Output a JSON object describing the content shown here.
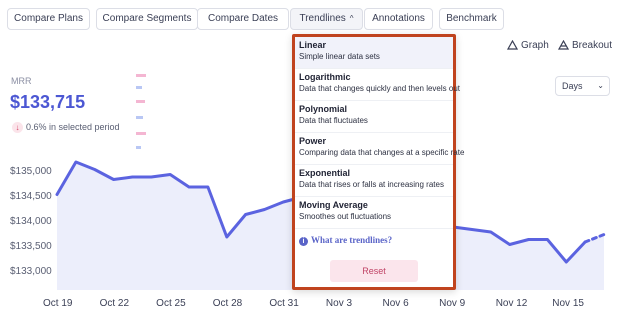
{
  "toolbar": {
    "buttons": [
      "Compare Plans",
      "Compare Segments",
      "Compare Dates",
      "Trendlines",
      "Annotations",
      "Benchmark"
    ],
    "trendlines_caret": "^"
  },
  "actions": {
    "graph": "Graph",
    "breakout": "Breakout"
  },
  "metric": {
    "label": "MRR",
    "value": "$133,715",
    "change": "0.6% in selected period",
    "change_direction": "down"
  },
  "period_select": {
    "value": "Days"
  },
  "chart_data": {
    "type": "area",
    "x": [
      "Oct 19",
      "Oct 20",
      "Oct 21",
      "Oct 22",
      "Oct 23",
      "Oct 24",
      "Oct 25",
      "Oct 26",
      "Oct 27",
      "Oct 28",
      "Oct 29",
      "Oct 30",
      "Oct 31",
      "Nov 1",
      "Nov 2",
      "Nov 3",
      "Nov 4",
      "Nov 5",
      "Nov 6",
      "Nov 7",
      "Nov 8",
      "Nov 9",
      "Nov 10",
      "Nov 11",
      "Nov 12",
      "Nov 13",
      "Nov 14",
      "Nov 15",
      "Nov 16",
      "Nov 17"
    ],
    "series": [
      {
        "values": [
          134550,
          135200,
          135050,
          134850,
          134900,
          134900,
          134950,
          134700,
          134700,
          133700,
          134150,
          134250,
          134400,
          134500,
          134350,
          134250,
          134150,
          134100,
          134050,
          134000,
          133950,
          133900,
          133850,
          133800,
          133550,
          133650,
          133650,
          133200,
          133600,
          133750
        ]
      }
    ],
    "last_segment_dashed_from_index": 28,
    "xticks": [
      "Oct 19",
      "Oct 22",
      "Oct 25",
      "Oct 28",
      "Oct 31",
      "Nov 3",
      "Nov 6",
      "Nov 9",
      "Nov 12",
      "Nov 15"
    ],
    "yticks": [
      "$135,000",
      "$134,500",
      "$134,000",
      "$133,500",
      "$133,000"
    ],
    "ylim": [
      132800,
      135400
    ],
    "line_color": "#5b63e0",
    "fill_color": "#eceefb"
  },
  "trendlines_menu": {
    "items": [
      {
        "title": "Linear",
        "desc": "Simple linear data sets"
      },
      {
        "title": "Logarithmic",
        "desc": "Data that changes quickly and then levels out"
      },
      {
        "title": "Polynomial",
        "desc": "Data that fluctuates"
      },
      {
        "title": "Power",
        "desc": "Comparing data that changes at a specific rate"
      },
      {
        "title": "Exponential",
        "desc": "Data that rises or falls at increasing rates"
      },
      {
        "title": "Moving Average",
        "desc": "Smoothes out fluctuations"
      }
    ],
    "help_link": "What are trendlines?",
    "reset_label": "Reset"
  }
}
